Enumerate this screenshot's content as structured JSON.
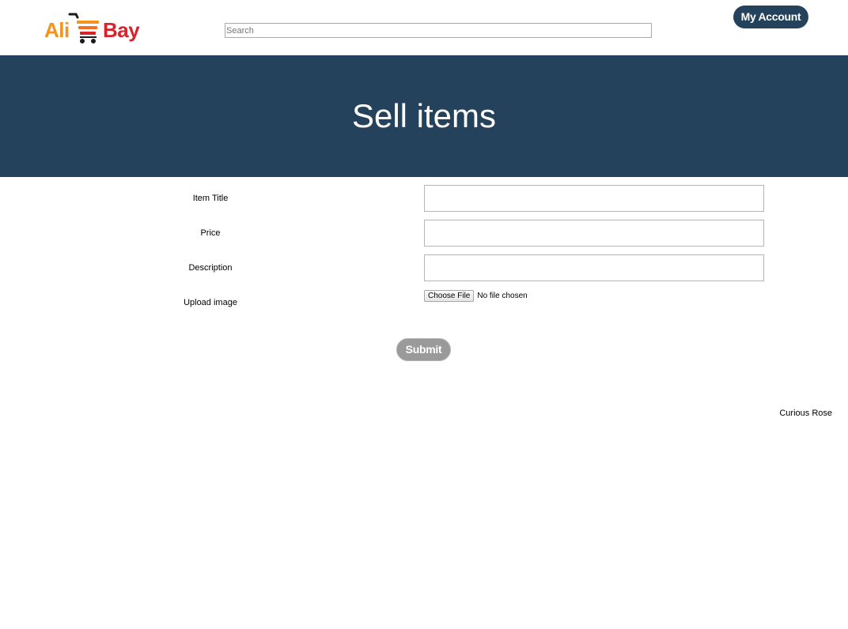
{
  "header": {
    "logo": {
      "part1": "Ali",
      "part2": "Bay",
      "icon": "shopping-cart-icon",
      "colors": {
        "part1": "#f6921e",
        "part2": "#d9232a"
      }
    },
    "search": {
      "placeholder": "Search",
      "value": ""
    },
    "account_button": "My Account"
  },
  "banner": {
    "title": "Sell items",
    "background": "#25425d"
  },
  "form": {
    "fields": [
      {
        "label": "Item Title",
        "value": ""
      },
      {
        "label": "Price",
        "value": ""
      },
      {
        "label": "Description",
        "value": ""
      }
    ],
    "upload": {
      "label": "Upload image",
      "button": "Choose File",
      "status": "No file chosen"
    },
    "submit": "Submit"
  },
  "footer": {
    "username": "Curious Rose"
  },
  "colors": {
    "accent": "#25425d",
    "submit_bg": "#9a9a9a"
  }
}
